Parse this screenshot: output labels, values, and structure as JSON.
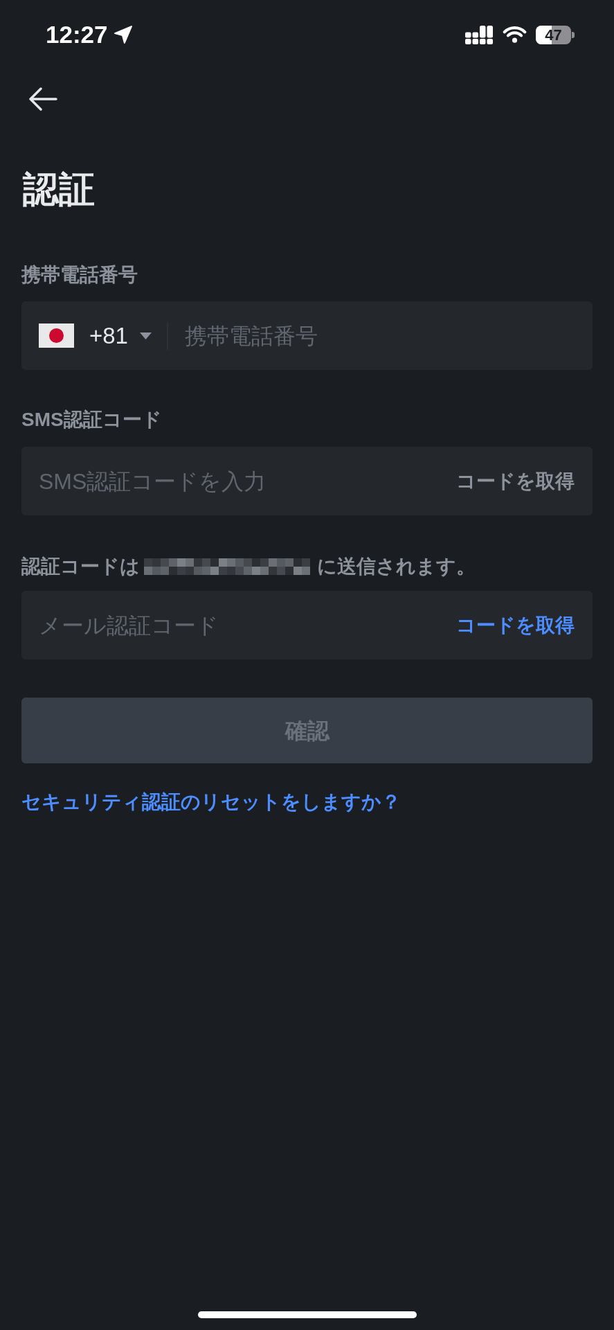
{
  "status_bar": {
    "time": "12:27",
    "battery": "47"
  },
  "title": "認証",
  "phone": {
    "label": "携帯電話番号",
    "country_code": "+81",
    "placeholder": "携帯電話番号"
  },
  "sms": {
    "label": "SMS認証コード",
    "placeholder": "SMS認証コードを入力",
    "action": {
      "label": "コードを取得",
      "disabled": true
    }
  },
  "email": {
    "notice_before": "認証コードは",
    "notice_after": "に送信されます。",
    "placeholder": "メール認証コード",
    "action": {
      "label": "コードを取得",
      "disabled": false
    }
  },
  "confirm_button": {
    "label": "確認",
    "disabled": true
  },
  "reset_link": "セキュリティ認証のリセットをしますか？"
}
